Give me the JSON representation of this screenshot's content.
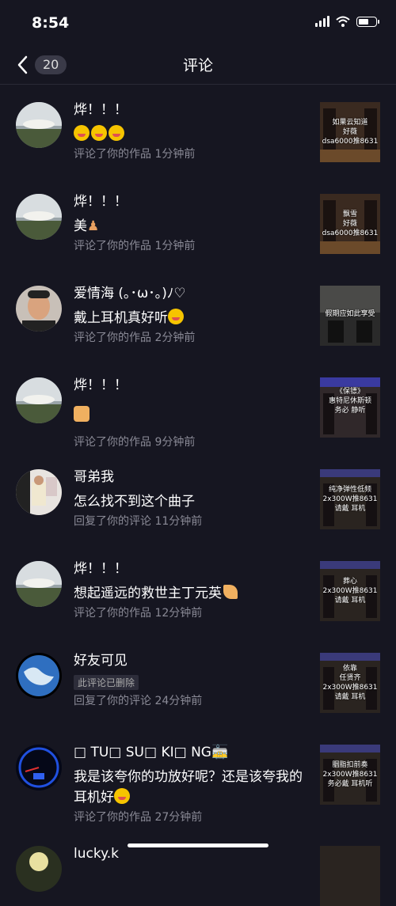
{
  "status": {
    "time": "8:54"
  },
  "header": {
    "title": "评论",
    "count": "20"
  },
  "items": [
    {
      "name": "烨！！！",
      "text": "",
      "meta": "评论了你的作品  1分钟前",
      "thumb": "如果云知道\n好薇\ndsa6000推8631",
      "emoji": "faces3"
    },
    {
      "name": "烨！！！",
      "text": "美",
      "meta": "评论了你的作品  1分钟前",
      "thumb": "飘雪\n好薇\ndsa6000推8631",
      "emoji": ""
    },
    {
      "name": "爱情海 (｡･ω･｡)ﾉ♡",
      "text": "戴上耳机真好听",
      "meta": "评论了你的作品  2分钟前",
      "thumb": "假期应如此享受",
      "emoji": ""
    },
    {
      "name": "烨！！！",
      "text": "",
      "meta": "评论了你的作品  9分钟前",
      "thumb": "《保镖》\n惠特尼休斯顿\n务必   静听",
      "emoji": "thumb"
    },
    {
      "name": "哥弟我",
      "text": "怎么找不到这个曲子",
      "meta": "回复了你的评论  11分钟前",
      "thumb": "纯净弹性低频\n2x300W推8631\n请戴   耳机",
      "emoji": ""
    },
    {
      "name": "烨！！！",
      "text": "想起遥远的救世主丁元英",
      "meta": "评论了你的作品  12分钟前",
      "thumb": "葬心\n2x300W推8631\n请戴   耳机",
      "emoji": ""
    },
    {
      "name": "好友可见",
      "text": "",
      "tag": "此评论已删除",
      "meta": "回复了你的评论  24分钟前",
      "thumb": "依靠\n任贤齐\n2x300W推8631\n请戴   耳机",
      "emoji": ""
    },
    {
      "name": "□ TU□  SU□  KI□  NG🚋",
      "text": "我是该夸你的功放好呢？还是该夸我的耳机好",
      "meta": "评论了你的作品  27分钟前",
      "thumb": "胭脂扣前奏\n2x300W推8631\n务必戴   耳机听",
      "emoji": ""
    },
    {
      "name": "lucky.k",
      "text": "",
      "meta": "",
      "thumb": "",
      "emoji": ""
    }
  ]
}
